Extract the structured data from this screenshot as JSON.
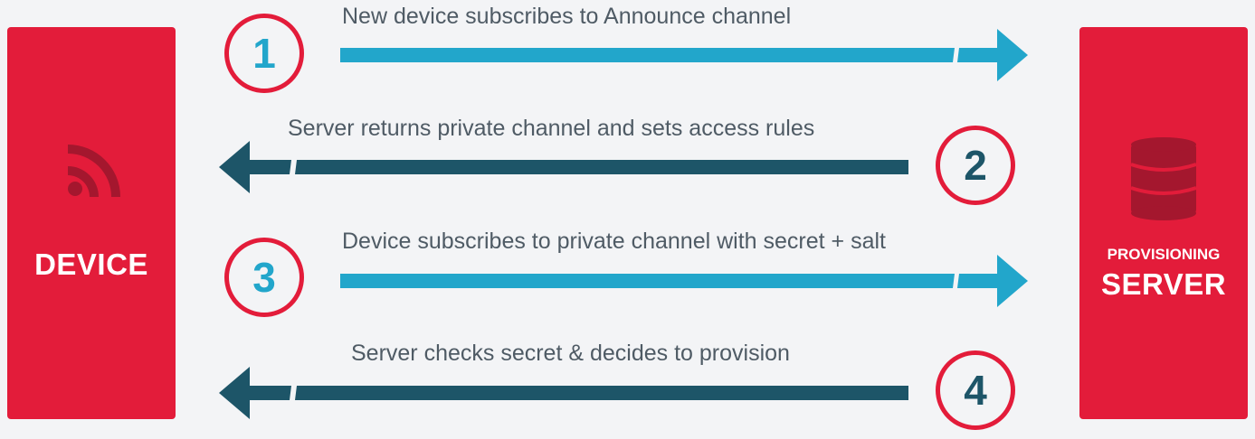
{
  "device": {
    "label": "DEVICE",
    "icon": "rss-icon"
  },
  "server": {
    "sub_label": "PROVISIONING",
    "label": "SERVER",
    "icon": "database-icon"
  },
  "steps": [
    {
      "number": "1",
      "text": "New device subscribes to Announce channel",
      "direction": "device-to-server"
    },
    {
      "number": "2",
      "text": "Server returns private channel and sets access rules",
      "direction": "server-to-device"
    },
    {
      "number": "3",
      "text": "Device subscribes to private channel with secret + salt",
      "direction": "device-to-server"
    },
    {
      "number": "4",
      "text": "Server checks secret & decides to provision",
      "direction": "server-to-device"
    }
  ],
  "colors": {
    "accent_red": "#e31c3a",
    "arrow_light": "#22a6cb",
    "arrow_dark": "#1d5568",
    "background": "#f3f4f6",
    "text": "#4f5b65"
  }
}
